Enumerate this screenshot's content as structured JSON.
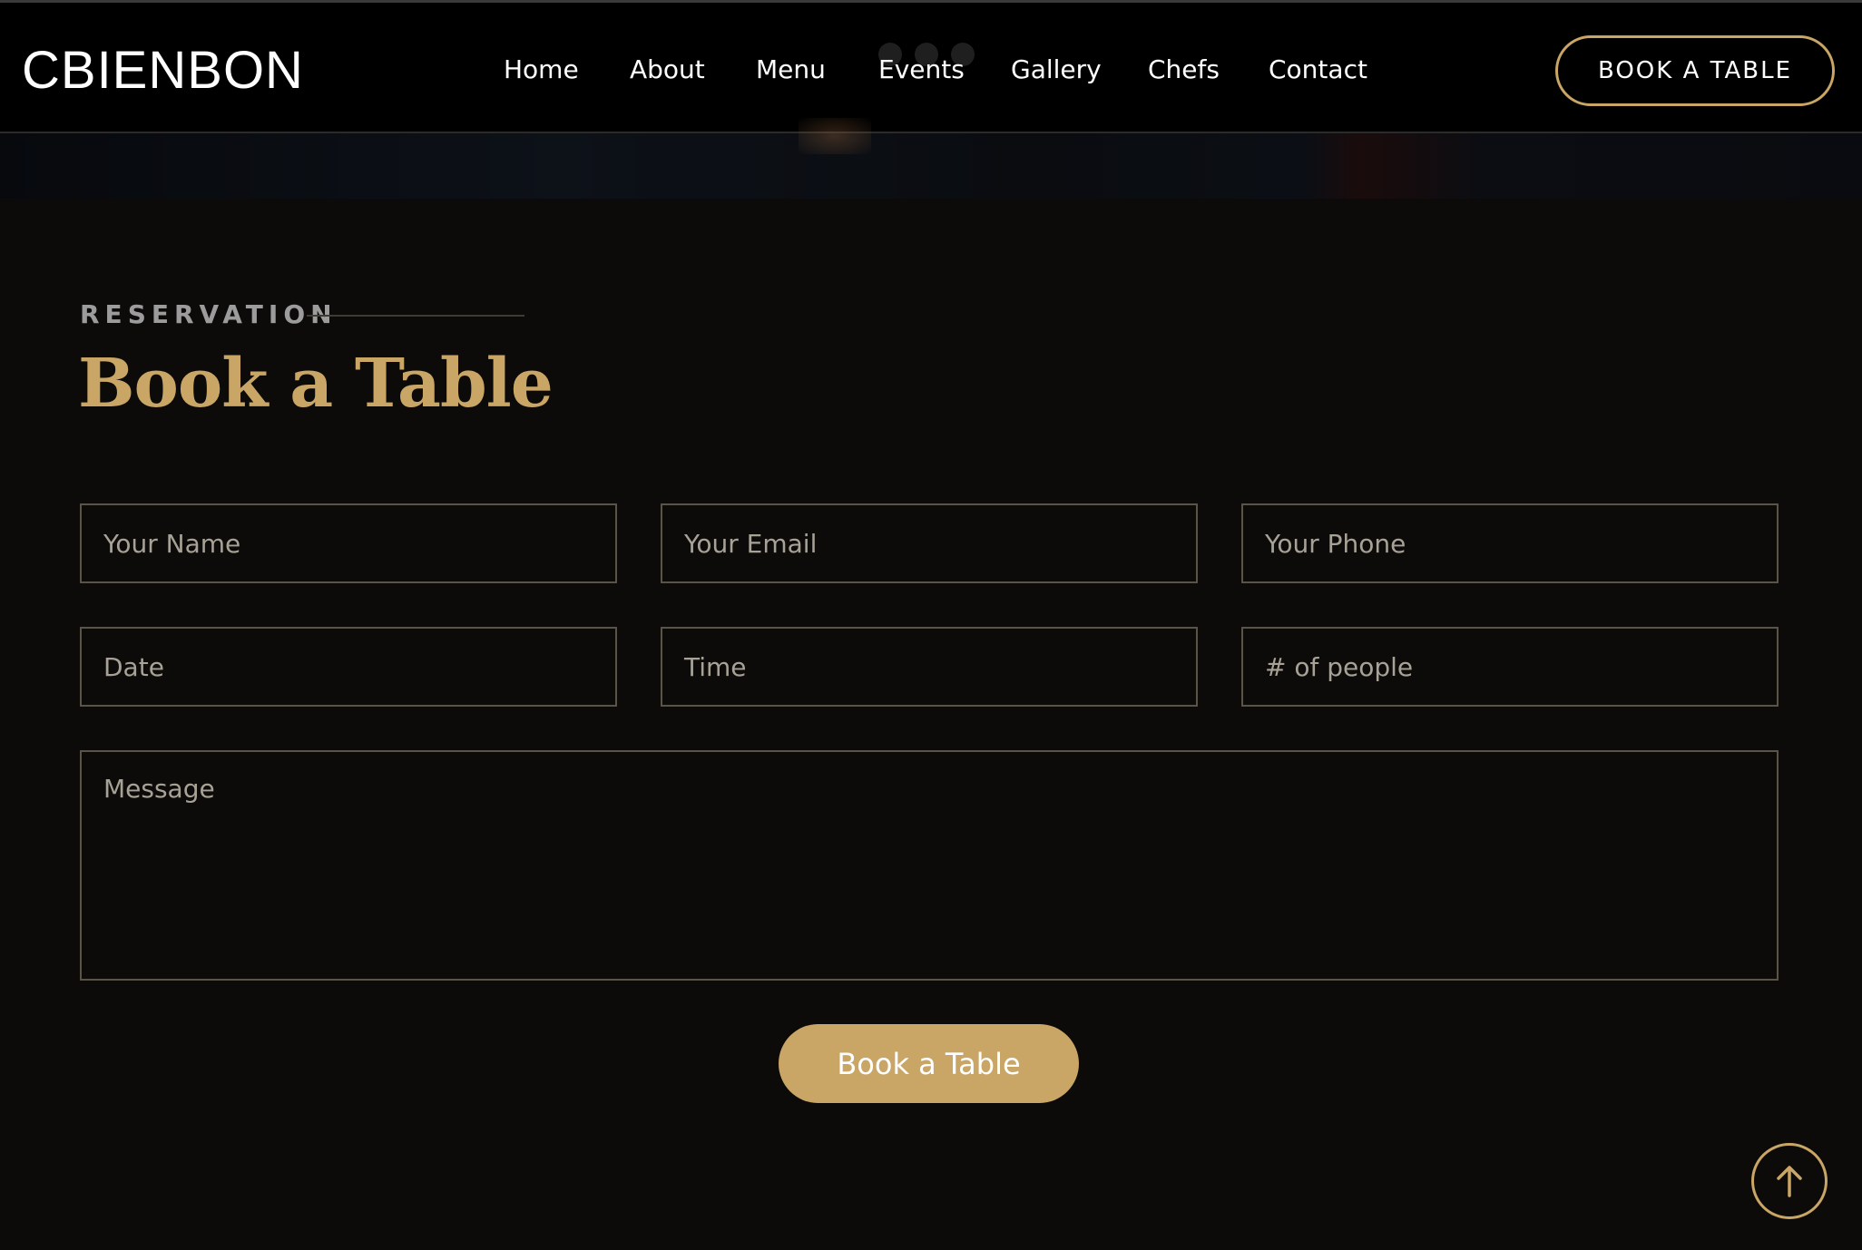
{
  "header": {
    "logo": "CBIENBON",
    "nav": [
      {
        "label": "Home"
      },
      {
        "label": "About"
      },
      {
        "label": "Menu"
      },
      {
        "label": "Events"
      },
      {
        "label": "Gallery"
      },
      {
        "label": "Chefs"
      },
      {
        "label": "Contact"
      }
    ],
    "cta_label": "BOOK A TABLE"
  },
  "reservation": {
    "eyebrow": "RESERVATION",
    "title": "Book a Table",
    "fields": {
      "name_placeholder": "Your Name",
      "email_placeholder": "Your Email",
      "phone_placeholder": "Your Phone",
      "date_placeholder": "Date",
      "time_placeholder": "Time",
      "people_placeholder": "# of people",
      "message_placeholder": "Message"
    },
    "submit_label": "Book a Table"
  },
  "icons": {
    "scroll_top": "arrow-up-icon"
  },
  "colors": {
    "accent": "#c9a665",
    "background": "#0c0b0a",
    "header_bg": "#000000",
    "field_border": "#5a5447",
    "placeholder_text": "#a8a296"
  }
}
